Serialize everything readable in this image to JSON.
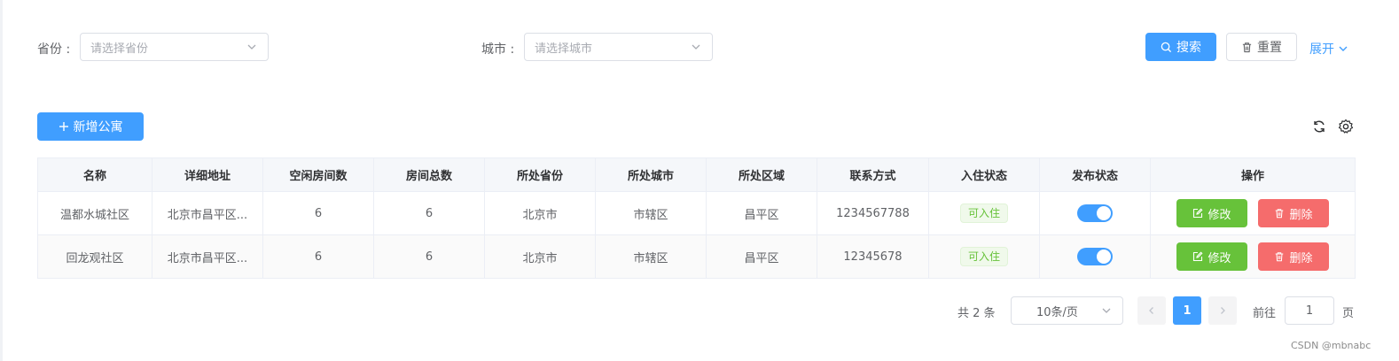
{
  "filters": {
    "province_label": "省份 :",
    "province_placeholder": "请选择省份",
    "city_label": "城市 :",
    "city_placeholder": "请选择城市",
    "search_label": "搜索",
    "reset_label": "重置",
    "expand_label": "展开"
  },
  "toolbar": {
    "add_label": "新增公寓"
  },
  "table": {
    "columns": [
      "名称",
      "详细地址",
      "空闲房间数",
      "房间总数",
      "所处省份",
      "所处城市",
      "所处区域",
      "联系方式",
      "入住状态",
      "发布状态",
      "操作"
    ],
    "rows": [
      {
        "name": "温都水城社区",
        "address": "北京市昌平区...",
        "free_rooms": "6",
        "total_rooms": "6",
        "province": "北京市",
        "city": "市辖区",
        "district": "昌平区",
        "phone": "1234567788",
        "checkin_status": "可入住",
        "published": true,
        "edit_label": "修改",
        "delete_label": "删除"
      },
      {
        "name": "回龙观社区",
        "address": "北京市昌平区...",
        "free_rooms": "6",
        "total_rooms": "6",
        "province": "北京市",
        "city": "市辖区",
        "district": "昌平区",
        "phone": "12345678",
        "checkin_status": "可入住",
        "published": true,
        "edit_label": "修改",
        "delete_label": "删除"
      }
    ]
  },
  "pagination": {
    "total_text": "共 2 条",
    "page_size": "10条/页",
    "current_page": "1",
    "goto_label": "前往",
    "goto_value": "1",
    "page_suffix": "页"
  },
  "watermark": "CSDN @mbnabc",
  "colors": {
    "primary": "#409eff",
    "success": "#67c23a",
    "danger": "#f56c6c"
  }
}
